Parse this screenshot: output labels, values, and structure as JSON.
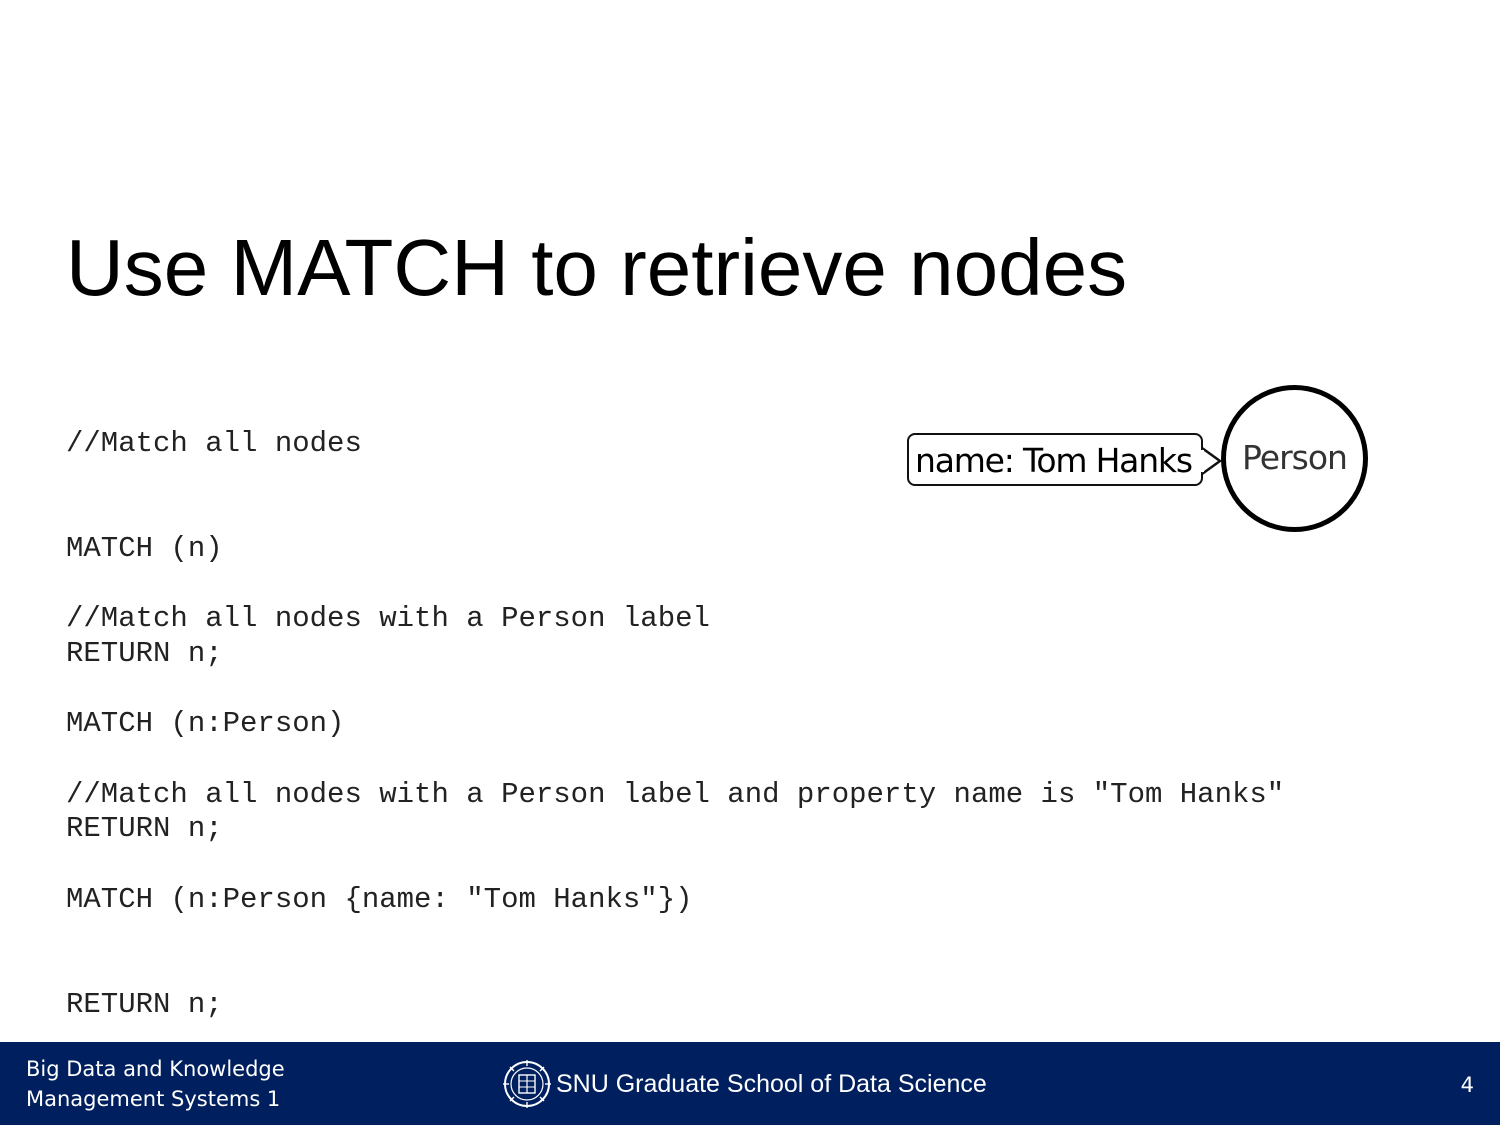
{
  "slide": {
    "title": "Use MATCH to retrieve nodes",
    "code_blocks": [
      {
        "lines": [
          "//Match all nodes",
          "MATCH (n)",
          "RETURN n;"
        ]
      },
      {
        "lines": [
          "//Match all nodes with a Person label",
          "MATCH (n:Person)",
          "RETURN n;"
        ]
      },
      {
        "lines": [
          "//Match all nodes with a Person label and property name is \"Tom Hanks\"",
          "MATCH (n:Person {name: \"Tom Hanks\"})",
          "RETURN n;"
        ]
      }
    ],
    "diagram": {
      "property_text": "name: Tom Hanks",
      "node_label": "Person"
    }
  },
  "footer": {
    "course_line_1": "Big Data and Knowledge",
    "course_line_2": "Management Systems 1",
    "school": "SNU Graduate School of Data Science",
    "page_number": "4",
    "logo_icon": "university-emblem-icon",
    "background_color": "#001f5f"
  }
}
